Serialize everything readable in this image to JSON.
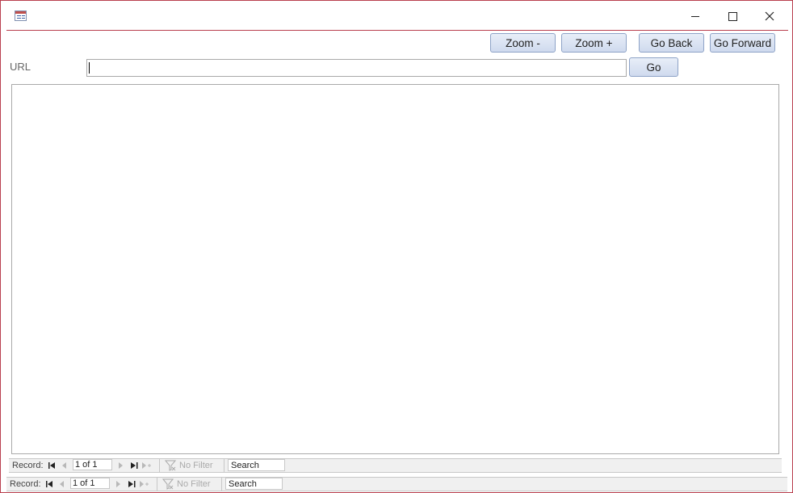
{
  "titlebar": {
    "icon": "form-icon",
    "controls": [
      "minimize",
      "maximize",
      "close"
    ]
  },
  "toolbar": {
    "zoom_out_label": "Zoom -",
    "zoom_in_label": "Zoom +",
    "go_back_label": "Go Back",
    "go_forward_label": "Go Forward"
  },
  "url_bar": {
    "label": "URL",
    "value": "",
    "go_label": "Go"
  },
  "record_nav_inner": {
    "label": "Record:",
    "position": "1 of 1",
    "filter_label": "No Filter",
    "search_label": "Search"
  },
  "record_nav_outer": {
    "label": "Record:",
    "position": "1 of 1",
    "filter_label": "No Filter",
    "search_label": "Search"
  },
  "colors": {
    "window_border": "#b9404f",
    "button_top": "#e8eef8",
    "button_bottom": "#cfdaee"
  }
}
